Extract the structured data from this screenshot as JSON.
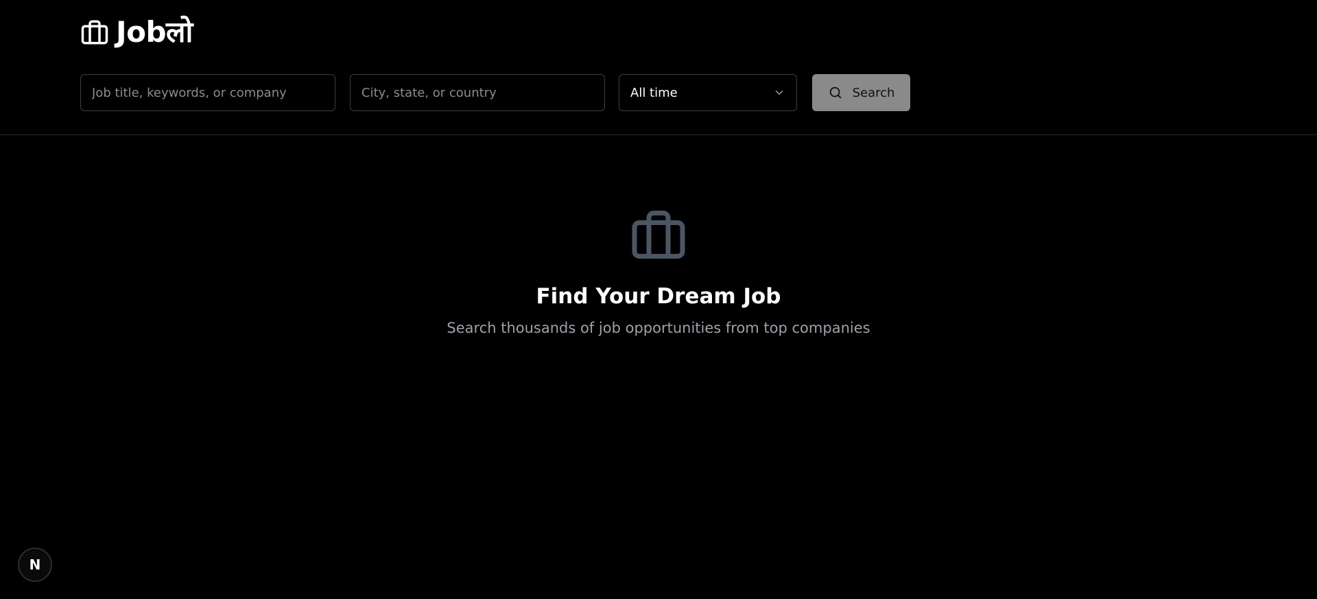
{
  "header": {
    "brand": "Jobलो",
    "icon": "briefcase-icon"
  },
  "search": {
    "job_placeholder": "Job title, keywords, or company",
    "location_placeholder": "City, state, or country",
    "time_filter": "All time",
    "button_label": "Search",
    "button_icon": "search-icon"
  },
  "hero": {
    "icon": "briefcase-icon",
    "title": "Find Your Dream Job",
    "subtitle": "Search thousands of job opportunities from top companies"
  },
  "badge": {
    "label": "N"
  },
  "colors": {
    "background": "#000000",
    "border": "#3f3f46",
    "button_bg": "#8a8a8a",
    "muted_text": "#a1a1aa",
    "hero_icon": "#4b5563"
  }
}
